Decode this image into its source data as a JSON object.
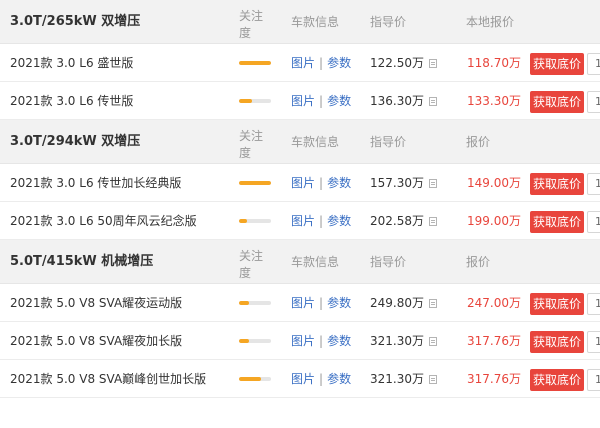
{
  "colors": {
    "accent_red": "#e8453c",
    "link_blue": "#3a6fc4",
    "bar_orange": "#f5a623"
  },
  "groups": [
    {
      "title": "3.0T/265kW 双增压",
      "columns": {
        "attention": "关注度",
        "specs": "车款信息",
        "guide": "指导价",
        "local": "本地报价"
      },
      "rows": [
        {
          "name": "2021款 3.0 L6 盛世版",
          "attention": 1.0,
          "pic": "图片",
          "sep": "|",
          "param": "参数",
          "guide_price": "122.50万",
          "local_price": "118.70万",
          "button": "获取底价",
          "edge": "1"
        },
        {
          "name": "2021款 3.0 L6 传世版",
          "attention": 0.4,
          "pic": "图片",
          "sep": "|",
          "param": "参数",
          "guide_price": "136.30万",
          "local_price": "133.30万",
          "button": "获取底价",
          "edge": "1"
        }
      ]
    },
    {
      "title": "3.0T/294kW 双增压",
      "columns": {
        "attention": "关注度",
        "specs": "车款信息",
        "guide": "指导价",
        "local": "报价"
      },
      "rows": [
        {
          "name": "2021款 3.0 L6 传世加长经典版",
          "attention": 1.0,
          "pic": "图片",
          "sep": "|",
          "param": "参数",
          "guide_price": "157.30万",
          "local_price": "149.00万",
          "button": "获取底价",
          "edge": "1"
        },
        {
          "name": "2021款 3.0 L6 50周年风云纪念版",
          "attention": 0.25,
          "pic": "图片",
          "sep": "|",
          "param": "参数",
          "guide_price": "202.58万",
          "local_price": "199.00万",
          "button": "获取底价",
          "edge": "1"
        }
      ]
    },
    {
      "title": "5.0T/415kW 机械增压",
      "columns": {
        "attention": "关注度",
        "specs": "车款信息",
        "guide": "指导价",
        "local": "报价"
      },
      "rows": [
        {
          "name": "2021款 5.0 V8 SVA耀夜运动版",
          "attention": 0.3,
          "pic": "图片",
          "sep": "|",
          "param": "参数",
          "guide_price": "249.80万",
          "local_price": "247.00万",
          "button": "获取底价",
          "edge": "1"
        },
        {
          "name": "2021款 5.0 V8 SVA耀夜加长版",
          "attention": 0.3,
          "pic": "图片",
          "sep": "|",
          "param": "参数",
          "guide_price": "321.30万",
          "local_price": "317.76万",
          "button": "获取底价",
          "edge": "1"
        },
        {
          "name": "2021款 5.0 V8 SVA巅峰创世加长版",
          "attention": 0.7,
          "pic": "图片",
          "sep": "|",
          "param": "参数",
          "guide_price": "321.30万",
          "local_price": "317.76万",
          "button": "获取底价",
          "edge": "1"
        }
      ]
    }
  ]
}
